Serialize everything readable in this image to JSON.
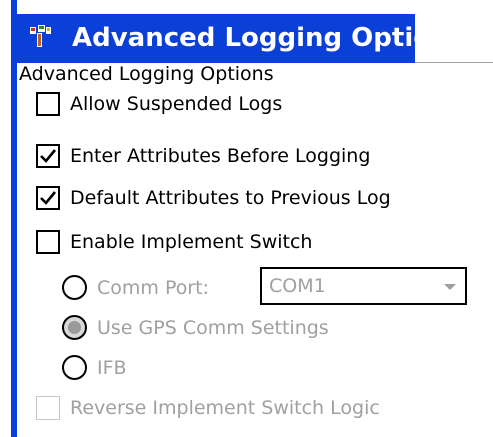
{
  "window": {
    "title": "Advanced Logging Options",
    "icon": "app-icon",
    "accent_color": "#0a3fd8"
  },
  "group": {
    "label": "Advanced Logging Options"
  },
  "options": {
    "allow_suspended_logs": {
      "label": "Allow Suspended Logs",
      "checked": false,
      "enabled": true
    },
    "enter_attributes_before_logging": {
      "label": "Enter Attributes Before Logging",
      "checked": true,
      "enabled": true
    },
    "default_attributes_to_previous_log": {
      "label": "Default Attributes to Previous Log",
      "checked": true,
      "enabled": true
    },
    "enable_implement_switch": {
      "label": "Enable Implement Switch",
      "checked": false,
      "enabled": true
    },
    "reverse_implement_switch_logic": {
      "label": "Reverse Implement Switch Logic",
      "checked": false,
      "enabled": false
    }
  },
  "implement_switch_source": {
    "comm_port": {
      "label": "Comm Port:",
      "selected": false,
      "enabled": false
    },
    "use_gps_comm_settings": {
      "label": "Use GPS Comm Settings",
      "selected": true,
      "enabled": false
    },
    "ifb": {
      "label": "IFB",
      "selected": false,
      "enabled": false
    }
  },
  "comm_port_select": {
    "value": "COM1",
    "enabled": false
  }
}
